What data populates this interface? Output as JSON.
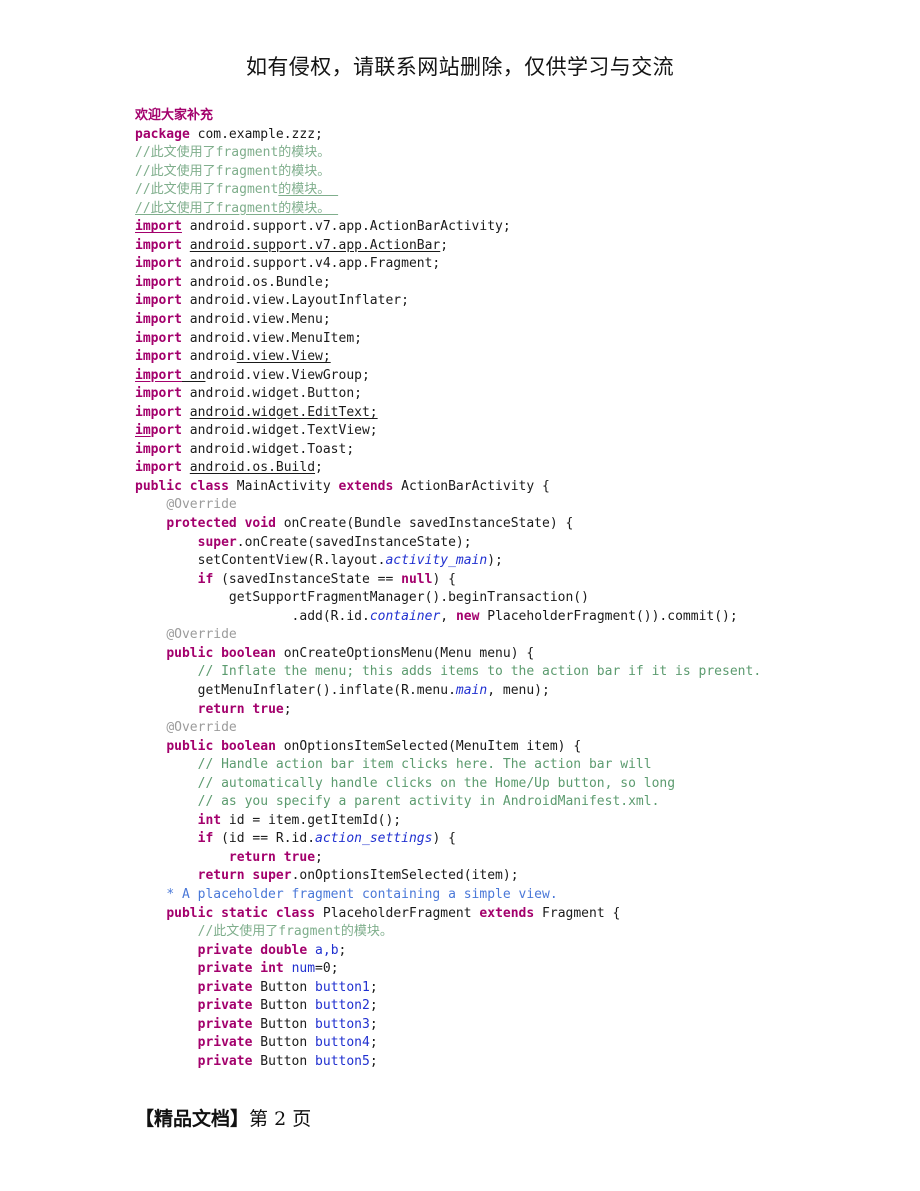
{
  "document": {
    "header_notice": "如有侵权，请联系网站删除，仅供学习与交流",
    "footer": {
      "label": "【精品文档】",
      "page_prefix": "第",
      "page_number": "2",
      "page_suffix": "页"
    }
  },
  "colors": {
    "keyword": "#a3006c",
    "comment_en": "#5c9b6f",
    "comment_cn": "#7fae8c",
    "javadoc": "#4a78d8",
    "annotation": "#9b9b9b",
    "field": "#2030d0",
    "plain": "#1a1a1a",
    "background": "#ffffff"
  },
  "code": {
    "language": "java",
    "lines": [
      {
        "id": 1,
        "indent": 0,
        "segments": [
          {
            "t": "欢迎大家补充",
            "c": "zhhead"
          }
        ]
      },
      {
        "id": 2,
        "indent": 0,
        "segments": [
          {
            "t": "package",
            "c": "kw"
          },
          {
            "t": " com.example.zzz;",
            "c": "plain"
          }
        ]
      },
      {
        "id": 3,
        "indent": 0,
        "segments": [
          {
            "t": "//此文使用了fragment的模块。",
            "c": "cmtcn"
          }
        ]
      },
      {
        "id": 4,
        "indent": 0,
        "segments": [
          {
            "t": "//此文使用了fragment的模块。",
            "c": "cmtcn"
          }
        ]
      },
      {
        "id": 5,
        "indent": 0,
        "segments": [
          {
            "t": "//此文使用了",
            "c": "cmtcn"
          },
          {
            "t": "fragment",
            "c": "cmtcn"
          },
          {
            "t": "的模块。 ",
            "c": "cmtcn u"
          }
        ]
      },
      {
        "id": 6,
        "indent": 0,
        "segments": [
          {
            "t": "//此文使用了fragment的模块。 ",
            "c": "cmtcn u"
          }
        ]
      },
      {
        "id": 7,
        "indent": 0,
        "segments": [
          {
            "t": "import",
            "c": "kw u"
          },
          {
            "t": " android.support.v7.app.ActionBarActivity;",
            "c": "plain"
          }
        ]
      },
      {
        "id": 8,
        "indent": 0,
        "segments": [
          {
            "t": "import",
            "c": "kw"
          },
          {
            "t": " ",
            "c": "plain"
          },
          {
            "t": "android.support.v7.app.ActionBar",
            "c": "plain u"
          },
          {
            "t": ";",
            "c": "plain"
          }
        ]
      },
      {
        "id": 9,
        "indent": 0,
        "segments": [
          {
            "t": "import",
            "c": "kw"
          },
          {
            "t": " android.support.v4.app.Fragment;",
            "c": "plain"
          }
        ]
      },
      {
        "id": 10,
        "indent": 0,
        "segments": [
          {
            "t": "import",
            "c": "kw"
          },
          {
            "t": " android.os.Bundle;",
            "c": "plain"
          }
        ]
      },
      {
        "id": 11,
        "indent": 0,
        "segments": [
          {
            "t": "import",
            "c": "kw"
          },
          {
            "t": " android.view.LayoutInflater;",
            "c": "plain"
          }
        ]
      },
      {
        "id": 12,
        "indent": 0,
        "segments": [
          {
            "t": "import",
            "c": "kw"
          },
          {
            "t": " android.view.Menu;",
            "c": "plain"
          }
        ]
      },
      {
        "id": 13,
        "indent": 0,
        "segments": [
          {
            "t": "import",
            "c": "kw"
          },
          {
            "t": " android.view.MenuItem;",
            "c": "plain"
          }
        ]
      },
      {
        "id": 14,
        "indent": 0,
        "segments": [
          {
            "t": "import",
            "c": "kw"
          },
          {
            "t": " androi",
            "c": "plain"
          },
          {
            "t": "d.view.View;",
            "c": "plain u"
          }
        ]
      },
      {
        "id": 15,
        "indent": 0,
        "segments": [
          {
            "t": "import",
            "c": "kw u"
          },
          {
            "t": " an",
            "c": "plain u"
          },
          {
            "t": "droid.view.ViewGroup;",
            "c": "plain"
          }
        ]
      },
      {
        "id": 16,
        "indent": 0,
        "segments": [
          {
            "t": "import",
            "c": "kw"
          },
          {
            "t": " android.widget.Button;",
            "c": "plain"
          }
        ]
      },
      {
        "id": 17,
        "indent": 0,
        "segments": [
          {
            "t": "import",
            "c": "kw"
          },
          {
            "t": " ",
            "c": "plain"
          },
          {
            "t": "android.widget.EditText;",
            "c": "plain u"
          }
        ]
      },
      {
        "id": 18,
        "indent": 0,
        "segments": [
          {
            "t": "im",
            "c": "kw u"
          },
          {
            "t": "port",
            "c": "kw"
          },
          {
            "t": " android.widget.TextView;",
            "c": "plain"
          }
        ]
      },
      {
        "id": 19,
        "indent": 0,
        "segments": [
          {
            "t": "import",
            "c": "kw"
          },
          {
            "t": " android.widget.Toast;",
            "c": "plain"
          }
        ]
      },
      {
        "id": 20,
        "indent": 0,
        "segments": [
          {
            "t": "import",
            "c": "kw"
          },
          {
            "t": " ",
            "c": "plain"
          },
          {
            "t": "android.os.Build",
            "c": "plain u"
          },
          {
            "t": ";",
            "c": "plain"
          }
        ]
      },
      {
        "id": 21,
        "indent": 0,
        "segments": [
          {
            "t": "public",
            "c": "kw"
          },
          {
            "t": " ",
            "c": "plain"
          },
          {
            "t": "class",
            "c": "kw"
          },
          {
            "t": " MainActivity ",
            "c": "plain"
          },
          {
            "t": "extends",
            "c": "kw"
          },
          {
            "t": " ActionBarActivity {",
            "c": "plain"
          }
        ]
      },
      {
        "id": 22,
        "indent": 1,
        "segments": [
          {
            "t": "@Override",
            "c": "ann"
          }
        ]
      },
      {
        "id": 23,
        "indent": 1,
        "segments": [
          {
            "t": "protected",
            "c": "kw"
          },
          {
            "t": " ",
            "c": "plain"
          },
          {
            "t": "void",
            "c": "kw"
          },
          {
            "t": " onCreate(Bundle savedInstanceState) {",
            "c": "plain"
          }
        ]
      },
      {
        "id": 24,
        "indent": 2,
        "segments": [
          {
            "t": "super",
            "c": "kw"
          },
          {
            "t": ".onCreate(savedInstanceState);",
            "c": "plain"
          }
        ]
      },
      {
        "id": 25,
        "indent": 2,
        "segments": [
          {
            "t": "setContentView(R.layout.",
            "c": "plain"
          },
          {
            "t": "activity_main",
            "c": "fldi"
          },
          {
            "t": ");",
            "c": "plain"
          }
        ]
      },
      {
        "id": 26,
        "indent": 2,
        "segments": [
          {
            "t": "if",
            "c": "kw"
          },
          {
            "t": " (savedInstanceState == ",
            "c": "plain"
          },
          {
            "t": "null",
            "c": "kw"
          },
          {
            "t": ") {",
            "c": "plain"
          }
        ]
      },
      {
        "id": 27,
        "indent": 3,
        "segments": [
          {
            "t": "getSupportFragmentManager().beginTransaction()",
            "c": "plain"
          }
        ]
      },
      {
        "id": 28,
        "indent": 5,
        "segments": [
          {
            "t": ".add(R.id.",
            "c": "plain"
          },
          {
            "t": "container",
            "c": "fldi"
          },
          {
            "t": ", ",
            "c": "plain"
          },
          {
            "t": "new",
            "c": "kw"
          },
          {
            "t": " PlaceholderFragment()).commit();",
            "c": "plain"
          }
        ]
      },
      {
        "id": 29,
        "indent": 1,
        "segments": [
          {
            "t": "@Override",
            "c": "ann"
          }
        ]
      },
      {
        "id": 30,
        "indent": 1,
        "segments": [
          {
            "t": "public",
            "c": "kw"
          },
          {
            "t": " ",
            "c": "plain"
          },
          {
            "t": "boolean",
            "c": "kw"
          },
          {
            "t": " onCreateOptionsMenu(Menu menu) {",
            "c": "plain"
          }
        ]
      },
      {
        "id": 31,
        "indent": 2,
        "segments": [
          {
            "t": "// Inflate the menu; this adds items to the action bar if it is present.",
            "c": "cmt"
          }
        ]
      },
      {
        "id": 32,
        "indent": 2,
        "segments": [
          {
            "t": "getMenuInflater().inflate(R.menu.",
            "c": "plain"
          },
          {
            "t": "main",
            "c": "fldi"
          },
          {
            "t": ", menu);",
            "c": "plain"
          }
        ]
      },
      {
        "id": 33,
        "indent": 2,
        "segments": [
          {
            "t": "return",
            "c": "kw"
          },
          {
            "t": " ",
            "c": "plain"
          },
          {
            "t": "true",
            "c": "kw"
          },
          {
            "t": ";",
            "c": "plain"
          }
        ]
      },
      {
        "id": 34,
        "indent": 1,
        "segments": [
          {
            "t": "@Override",
            "c": "ann"
          }
        ]
      },
      {
        "id": 35,
        "indent": 1,
        "segments": [
          {
            "t": "public",
            "c": "kw"
          },
          {
            "t": " ",
            "c": "plain"
          },
          {
            "t": "boolean",
            "c": "kw"
          },
          {
            "t": " onOptionsItemSelected(MenuItem item) {",
            "c": "plain"
          }
        ]
      },
      {
        "id": 36,
        "indent": 2,
        "segments": [
          {
            "t": "// Handle action bar item clicks here. The action bar will",
            "c": "cmt"
          }
        ]
      },
      {
        "id": 37,
        "indent": 2,
        "segments": [
          {
            "t": "// automatically handle clicks on the Home/Up button, so long",
            "c": "cmt"
          }
        ]
      },
      {
        "id": 38,
        "indent": 2,
        "segments": [
          {
            "t": "// as you specify a parent activity in AndroidManifest.xml.",
            "c": "cmt"
          }
        ]
      },
      {
        "id": 39,
        "indent": 2,
        "segments": [
          {
            "t": "int",
            "c": "kw"
          },
          {
            "t": " id = item.getItemId();",
            "c": "plain"
          }
        ]
      },
      {
        "id": 40,
        "indent": 2,
        "segments": [
          {
            "t": "if",
            "c": "kw"
          },
          {
            "t": " (id == R.id.",
            "c": "plain"
          },
          {
            "t": "action_settings",
            "c": "fldi"
          },
          {
            "t": ") {",
            "c": "plain"
          }
        ]
      },
      {
        "id": 41,
        "indent": 3,
        "segments": [
          {
            "t": "return",
            "c": "kw"
          },
          {
            "t": " ",
            "c": "plain"
          },
          {
            "t": "true",
            "c": "kw"
          },
          {
            "t": ";",
            "c": "plain"
          }
        ]
      },
      {
        "id": 42,
        "indent": 2,
        "segments": [
          {
            "t": "return",
            "c": "kw"
          },
          {
            "t": " ",
            "c": "plain"
          },
          {
            "t": "super",
            "c": "kw"
          },
          {
            "t": ".onOptionsItemSelected(item);",
            "c": "plain"
          }
        ]
      },
      {
        "id": 43,
        "indent": 1,
        "segments": [
          {
            "t": "* A placeholder fragment containing a simple view.",
            "c": "doc"
          }
        ]
      },
      {
        "id": 44,
        "indent": 1,
        "segments": [
          {
            "t": "public",
            "c": "kw"
          },
          {
            "t": " ",
            "c": "plain"
          },
          {
            "t": "static",
            "c": "kw"
          },
          {
            "t": " ",
            "c": "plain"
          },
          {
            "t": "class",
            "c": "kw"
          },
          {
            "t": " PlaceholderFragment ",
            "c": "plain"
          },
          {
            "t": "extends",
            "c": "kw"
          },
          {
            "t": " Fragment {",
            "c": "plain"
          }
        ]
      },
      {
        "id": 45,
        "indent": 2,
        "segments": [
          {
            "t": "//此文使用了fragment的模块。",
            "c": "cmtcn"
          }
        ]
      },
      {
        "id": 46,
        "indent": 2,
        "segments": [
          {
            "t": "private",
            "c": "kw"
          },
          {
            "t": " ",
            "c": "plain"
          },
          {
            "t": "double",
            "c": "kw"
          },
          {
            "t": " ",
            "c": "plain"
          },
          {
            "t": "a,b",
            "c": "fld"
          },
          {
            "t": ";",
            "c": "plain"
          }
        ]
      },
      {
        "id": 47,
        "indent": 2,
        "segments": [
          {
            "t": "private",
            "c": "kw"
          },
          {
            "t": " ",
            "c": "plain"
          },
          {
            "t": "int",
            "c": "kw"
          },
          {
            "t": " ",
            "c": "plain"
          },
          {
            "t": "num",
            "c": "fld"
          },
          {
            "t": "=0;",
            "c": "plain"
          }
        ]
      },
      {
        "id": 48,
        "indent": 2,
        "segments": [
          {
            "t": "private",
            "c": "kw"
          },
          {
            "t": " Button ",
            "c": "plain"
          },
          {
            "t": "button1",
            "c": "fld"
          },
          {
            "t": ";",
            "c": "plain"
          }
        ]
      },
      {
        "id": 49,
        "indent": 2,
        "segments": [
          {
            "t": "private",
            "c": "kw"
          },
          {
            "t": " Button ",
            "c": "plain"
          },
          {
            "t": "button2",
            "c": "fld"
          },
          {
            "t": ";",
            "c": "plain"
          }
        ]
      },
      {
        "id": 50,
        "indent": 2,
        "segments": [
          {
            "t": "private",
            "c": "kw"
          },
          {
            "t": " Button ",
            "c": "plain"
          },
          {
            "t": "button3",
            "c": "fld"
          },
          {
            "t": ";",
            "c": "plain"
          }
        ]
      },
      {
        "id": 51,
        "indent": 2,
        "segments": [
          {
            "t": "private",
            "c": "kw"
          },
          {
            "t": " Button ",
            "c": "plain"
          },
          {
            "t": "button4",
            "c": "fld"
          },
          {
            "t": ";",
            "c": "plain"
          }
        ]
      },
      {
        "id": 52,
        "indent": 2,
        "segments": [
          {
            "t": "private",
            "c": "kw"
          },
          {
            "t": " Button ",
            "c": "plain"
          },
          {
            "t": "button5",
            "c": "fld"
          },
          {
            "t": ";",
            "c": "plain"
          }
        ]
      }
    ]
  }
}
